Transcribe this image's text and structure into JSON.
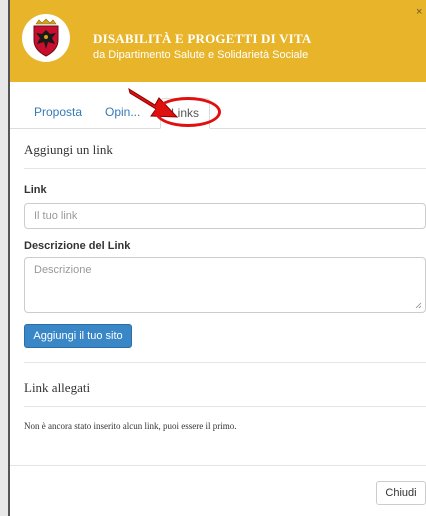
{
  "header": {
    "title": "DISABILITÀ E PROGETTI DI VITA",
    "subtitle": "da Dipartimento Salute e Solidarietà Sociale",
    "close_symbol": "×",
    "logo_icon": "coat-of-arms-icon"
  },
  "tabs": [
    {
      "label": "Proposta",
      "active": false
    },
    {
      "label": "Opin...",
      "active": false
    },
    {
      "label": "Links",
      "active": true
    }
  ],
  "annotation": {
    "arrow_color": "#e01010",
    "circle_color": "#e01010"
  },
  "form": {
    "section_title": "Aggiungi un link",
    "link_label": "Link",
    "link_placeholder": "Il tuo link",
    "description_label": "Descrizione del Link",
    "description_placeholder": "Descrizione",
    "submit_label": "Aggiungi il tuo sito"
  },
  "attached": {
    "section_title": "Link allegati",
    "empty_message": "Non è ancora stato inserito alcun link, puoi essere il primo."
  },
  "footer": {
    "close_label": "Chiudi"
  },
  "colors": {
    "header_bg": "#e8b52a",
    "primary": "#3a87c8",
    "tab_link": "#337ab7"
  }
}
